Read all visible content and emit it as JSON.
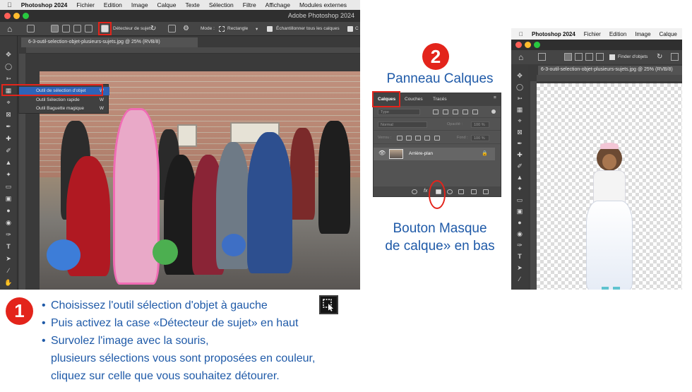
{
  "left_screenshot": {
    "menubar": {
      "app_name": "Photoshop 2024",
      "items": [
        "Fichier",
        "Edition",
        "Image",
        "Calque",
        "Texte",
        "Sélection",
        "Filtre",
        "Affichage",
        "Modules externes"
      ]
    },
    "window_title": "Adobe Photoshop 2024",
    "options_bar": {
      "subject_detector_label": "Détecteur de sujets",
      "mode_label": "Mode :",
      "mode_value": "Rectangle",
      "sample_all_layers_label": "Échantillonner tous les calques",
      "truncated_label": "C"
    },
    "document_tab": "6-3-outil-selection-objet-plusieurs-sujets.jpg @ 25% (RVB/8)",
    "tool_flyout": [
      {
        "label": "Outil de sélection d'objet",
        "shortcut": "W"
      },
      {
        "label": "Outil Sélection rapide",
        "shortcut": "W"
      },
      {
        "label": "Outil Baguette magique",
        "shortcut": "W"
      }
    ]
  },
  "step1": {
    "number": "1",
    "bullets": [
      "Choisissez l'outil sélection d'objet à gauche",
      "Puis activez la case «Détecteur de sujet» en haut",
      "Survolez l'image avec la souris,"
    ],
    "continuation": [
      "plusieurs sélections vous sont proposées en couleur,",
      "cliquez sur celle que vous souhaitez détourer."
    ]
  },
  "step2": {
    "number": "2",
    "title": "Panneau Calques",
    "panel": {
      "tabs": [
        "Calques",
        "Couches",
        "Tracés"
      ],
      "search_placeholder": "Type",
      "blend_mode": "Normal",
      "opacity_label": "Opacité :",
      "opacity_value": "100 %",
      "lock_label": "Verrou :",
      "fill_label": "Fond :",
      "fill_value": "100 %",
      "layer_name": "Arrière-plan"
    },
    "caption_lines": [
      "Bouton Masque",
      "de calque» en bas"
    ]
  },
  "right_screenshot": {
    "menubar": {
      "app_name": "Photoshop 2024",
      "items": [
        "Fichier",
        "Edition",
        "Image",
        "Calque"
      ]
    },
    "options_bar": {
      "object_finder_label": "Finder d'objets"
    },
    "document_tab": "6-3-outil-selection-objet-plusieurs-sujets.jpg @ 25% (RVB/8)"
  },
  "colors": {
    "accent_red": "#e3241b",
    "text_blue": "#1f5aa8",
    "ps_dark": "#3a3a3a",
    "selection_pink": "#f06bb4"
  }
}
